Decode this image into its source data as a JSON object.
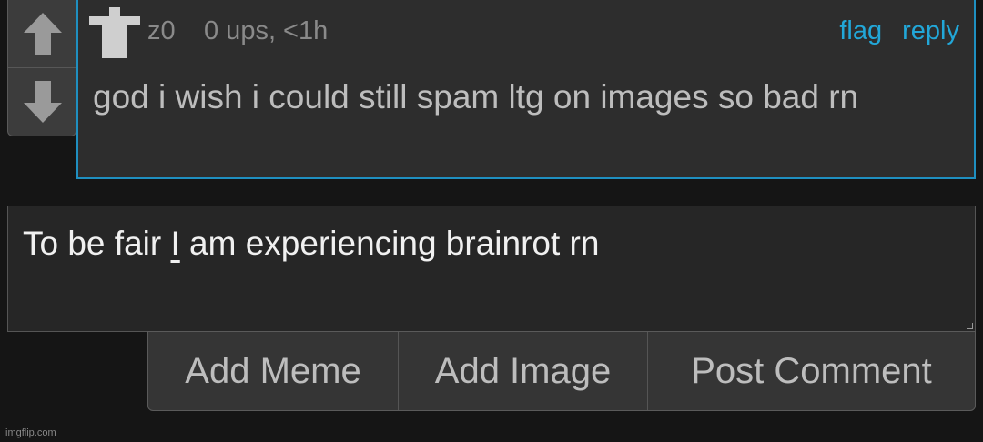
{
  "comment": {
    "username": "z0",
    "meta": "0 ups, <1h",
    "flag_label": "flag",
    "reply_label": "reply",
    "body": "god i wish i could still spam ltg on images so bad rn"
  },
  "vote": {
    "up_icon": "arrow-up-icon",
    "down_icon": "arrow-down-icon"
  },
  "reply_box": {
    "text_before": "To be fair ",
    "text_cursor": "I",
    "text_after": " am experiencing brainrot rn"
  },
  "buttons": {
    "add_meme": "Add Meme",
    "add_image": "Add Image",
    "post_comment": "Post Comment"
  },
  "watermark": "imgflip.com",
  "colors": {
    "accent": "#22a7d8",
    "background": "#151515",
    "panel": "#2d2d2d"
  }
}
